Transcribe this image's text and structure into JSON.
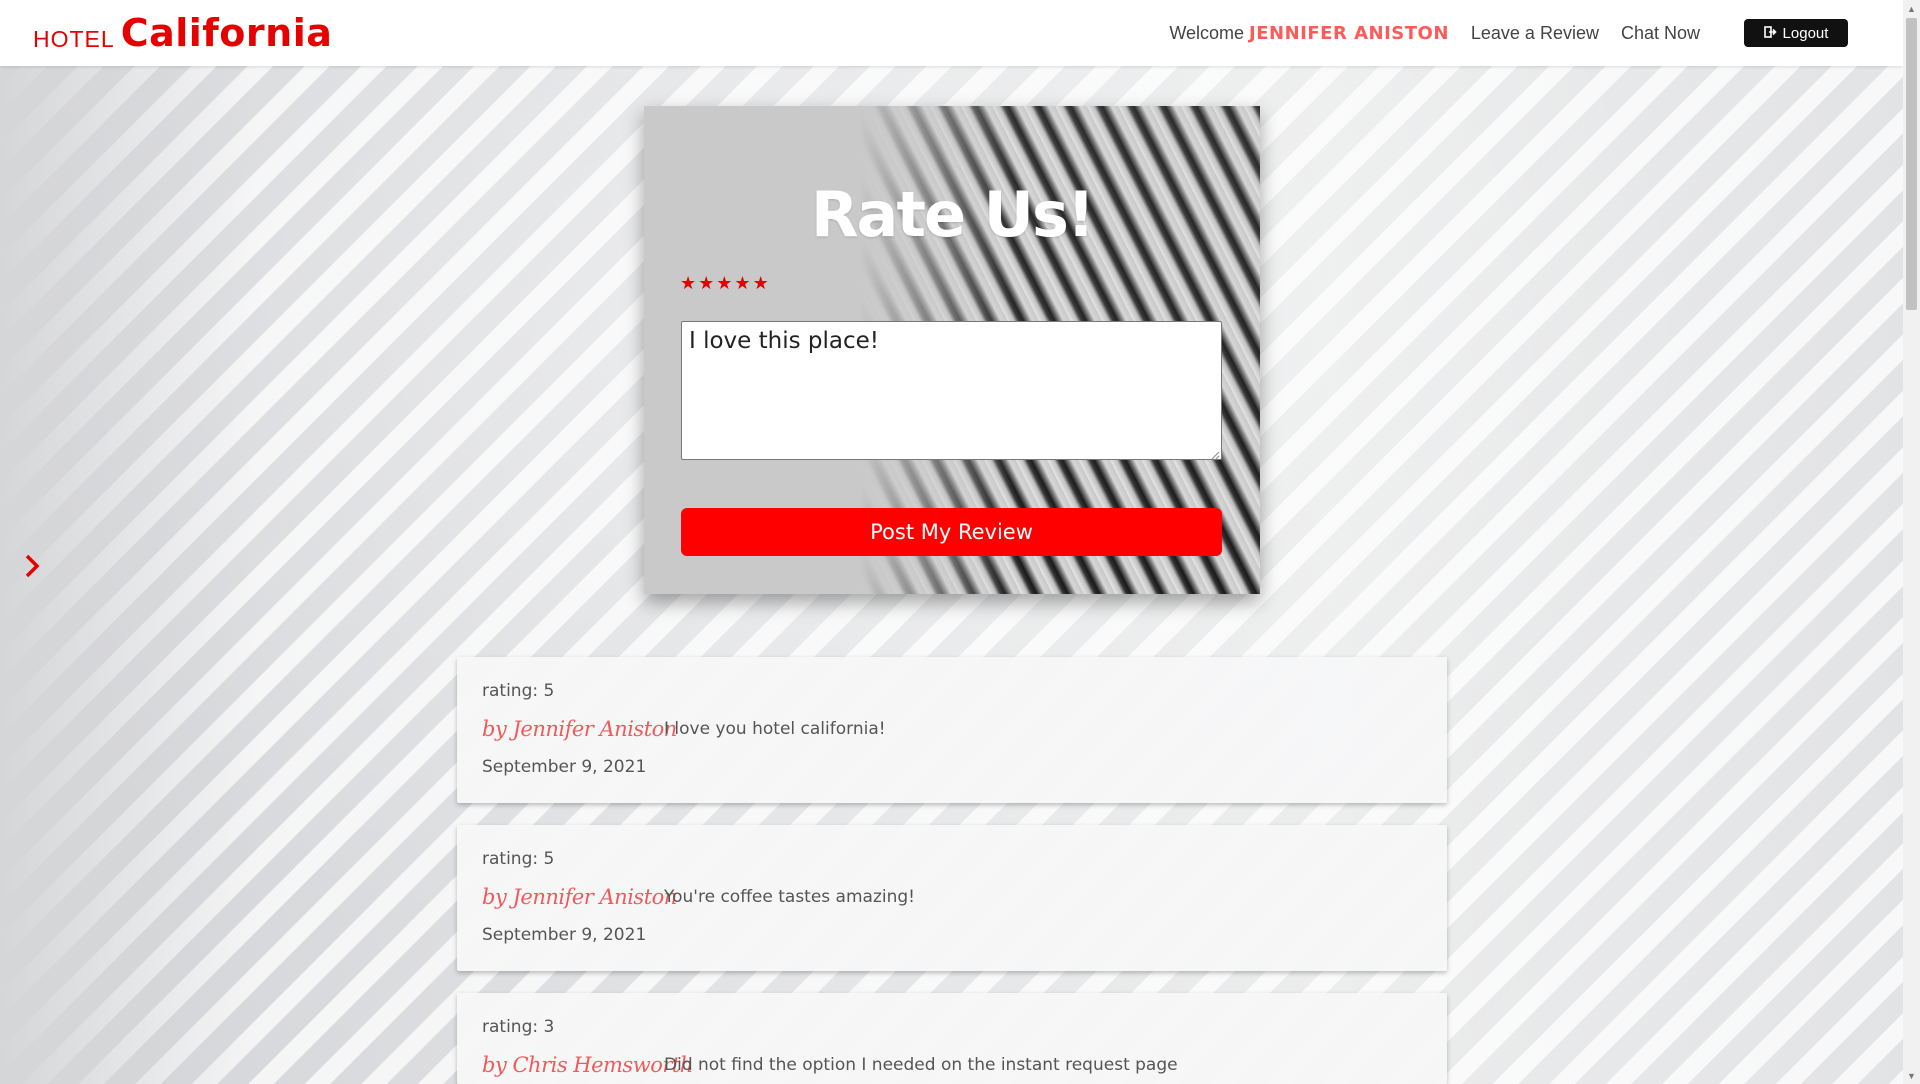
{
  "header": {
    "brand_prefix": "HOTEL",
    "brand_name": "California",
    "welcome_label": "Welcome",
    "user_name": "Jennifer Aniston",
    "nav": [
      {
        "label": "Leave a Review"
      },
      {
        "label": "Chat Now"
      }
    ],
    "logout_label": "Logout"
  },
  "rate_form": {
    "title": "Rate Us!",
    "rating": 5,
    "max_rating": 5,
    "stars": [
      "★",
      "★",
      "★",
      "★",
      "★"
    ],
    "review_value": "I love this place!",
    "submit_label": "Post My Review",
    "accent_color": "#ff0000"
  },
  "reviews": [
    {
      "rating_text": "rating: 5",
      "author": "by Jennifer Aniston",
      "date": "September 9, 2021",
      "text": "I love you hotel california!"
    },
    {
      "rating_text": "rating: 5",
      "author": "by Jennifer Aniston",
      "date": "September 9, 2021",
      "text": "You're coffee tastes amazing!"
    },
    {
      "rating_text": "rating: 3",
      "author": "by Chris Hemsworth",
      "date": "",
      "text": "Did not find the option I needed on the instant request page"
    }
  ]
}
